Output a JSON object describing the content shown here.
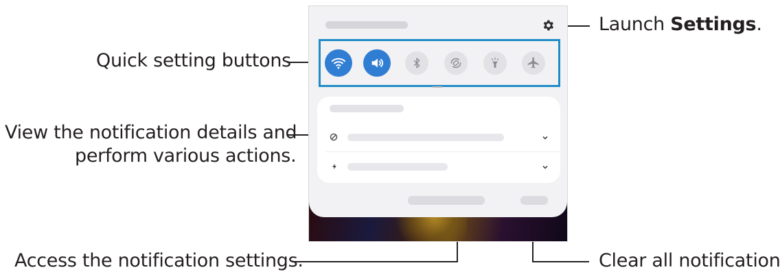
{
  "callouts": {
    "launch_prefix": "Launch ",
    "launch_bold": "Settings",
    "launch_suffix": ".",
    "quick_settings": "Quick setting buttons",
    "notif_details_line1": "View the notification details and",
    "notif_details_line2": "perform various actions.",
    "notif_settings": "Access the notification settings.",
    "clear_all": "Clear all notifications."
  },
  "quick_buttons": [
    {
      "icon": "wifi-icon",
      "state": "on"
    },
    {
      "icon": "sound-icon",
      "state": "on"
    },
    {
      "icon": "bluetooth-icon",
      "state": "off"
    },
    {
      "icon": "auto-rotate-icon",
      "state": "off"
    },
    {
      "icon": "flashlight-icon",
      "state": "off"
    },
    {
      "icon": "airplane-mode-icon",
      "state": "off"
    }
  ],
  "colors": {
    "accent_blue": "#2f7ed3",
    "highlight_border": "#1f8bc6",
    "callout_line": "#231f20"
  }
}
